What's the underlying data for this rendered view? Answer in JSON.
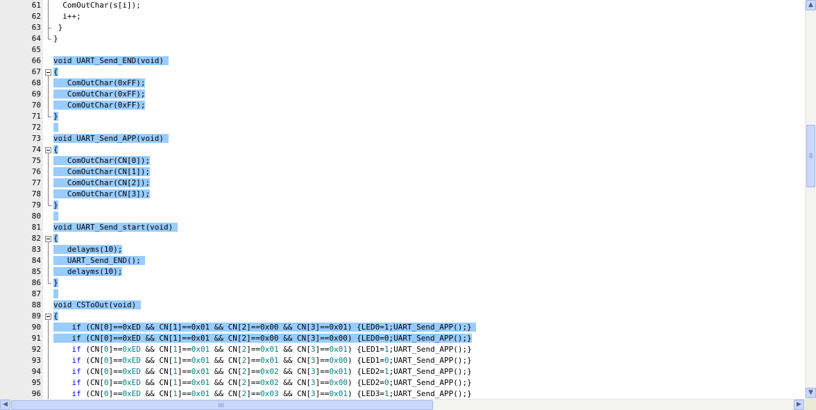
{
  "editor": {
    "lines": [
      {
        "n": "61",
        "indent": "  ",
        "segs": [
          {
            "t": "ComOutChar(s[i]);"
          }
        ]
      },
      {
        "n": "62",
        "indent": "  ",
        "segs": [
          {
            "t": "i++;"
          }
        ]
      },
      {
        "n": "63",
        "indent": " ",
        "segs": [
          {
            "t": "}"
          }
        ]
      },
      {
        "n": "64",
        "indent": "",
        "segs": [
          {
            "t": "}"
          }
        ]
      },
      {
        "n": "65",
        "indent": "",
        "segs": [
          {
            "t": ""
          }
        ]
      },
      {
        "n": "66",
        "indent": "",
        "sel": true,
        "segs": [
          {
            "t": "void UART_Send_END(void) "
          }
        ]
      },
      {
        "n": "67",
        "indent": "",
        "sel": true,
        "segs": [
          {
            "t": "{"
          }
        ]
      },
      {
        "n": "68",
        "indent": "",
        "sel": true,
        "segs": [
          {
            "t": "   ComOutChar(0xFF);"
          }
        ]
      },
      {
        "n": "69",
        "indent": "",
        "sel": true,
        "segs": [
          {
            "t": "   ComOutChar(0xFF);"
          }
        ]
      },
      {
        "n": "70",
        "indent": "",
        "sel": true,
        "segs": [
          {
            "t": "   ComOutChar(0xFF);"
          }
        ]
      },
      {
        "n": "71",
        "indent": "",
        "sel": true,
        "segs": [
          {
            "t": "}"
          }
        ]
      },
      {
        "n": "72",
        "indent": "",
        "sel": true,
        "segs": [
          {
            "t": " "
          }
        ]
      },
      {
        "n": "73",
        "indent": "",
        "sel": true,
        "segs": [
          {
            "t": "void UART_Send_APP(void) "
          }
        ]
      },
      {
        "n": "74",
        "indent": "",
        "sel": true,
        "segs": [
          {
            "t": "{"
          }
        ]
      },
      {
        "n": "75",
        "indent": "",
        "sel": true,
        "segs": [
          {
            "t": "   ComOutChar(CN[0]);"
          }
        ]
      },
      {
        "n": "76",
        "indent": "",
        "sel": true,
        "segs": [
          {
            "t": "   ComOutChar(CN[1]);"
          }
        ]
      },
      {
        "n": "77",
        "indent": "",
        "sel": true,
        "segs": [
          {
            "t": "   ComOutChar(CN[2]);"
          }
        ]
      },
      {
        "n": "78",
        "indent": "",
        "sel": true,
        "segs": [
          {
            "t": "   ComOutChar(CN[3]);"
          }
        ]
      },
      {
        "n": "79",
        "indent": "",
        "sel": true,
        "segs": [
          {
            "t": "}"
          }
        ]
      },
      {
        "n": "80",
        "indent": "",
        "sel": true,
        "segs": [
          {
            "t": " "
          }
        ]
      },
      {
        "n": "81",
        "indent": "",
        "sel": true,
        "segs": [
          {
            "t": "void UART_Send_start(void) "
          }
        ]
      },
      {
        "n": "82",
        "indent": "",
        "sel": true,
        "segs": [
          {
            "t": "{"
          }
        ]
      },
      {
        "n": "83",
        "indent": "",
        "sel": true,
        "segs": [
          {
            "t": "   delayms(10);"
          }
        ]
      },
      {
        "n": "84",
        "indent": "",
        "sel": true,
        "segs": [
          {
            "t": "   UART_Send_END(); "
          }
        ]
      },
      {
        "n": "85",
        "indent": "",
        "sel": true,
        "segs": [
          {
            "t": "   delayms(10);"
          }
        ]
      },
      {
        "n": "86",
        "indent": "",
        "sel": true,
        "segs": [
          {
            "t": "}"
          }
        ]
      },
      {
        "n": "87",
        "indent": "",
        "sel": true,
        "segs": [
          {
            "t": " "
          }
        ]
      },
      {
        "n": "88",
        "indent": "",
        "sel": true,
        "segs": [
          {
            "t": "void CSToOut(void) "
          }
        ]
      },
      {
        "n": "89",
        "indent": "",
        "sel": true,
        "segs": [
          {
            "t": "{"
          }
        ]
      },
      {
        "n": "90",
        "indent": "",
        "sel": true,
        "segs": [
          {
            "t": "    if (CN[0]==0xED && CN[1]==0x01 && CN[2]==0x00 && CN[3]==0x01) {LED0=1;UART_Send_APP();} "
          }
        ]
      },
      {
        "n": "91",
        "indent": "",
        "sel": true,
        "segs": [
          {
            "t": "    if (CN[0]==0xED && CN[1]==0x01 && CN[2]==0x00 && CN[3]==0x00) {LED0=0;UART_Send_APP();}"
          }
        ]
      },
      {
        "n": "92",
        "indent": "    ",
        "segs": [
          {
            "t": "if",
            "c": "kw"
          },
          {
            "t": " (CN["
          },
          {
            "t": "0",
            "c": "num"
          },
          {
            "t": "]=="
          },
          {
            "t": "0xED",
            "c": "num"
          },
          {
            "t": " && CN["
          },
          {
            "t": "1",
            "c": "num"
          },
          {
            "t": "]=="
          },
          {
            "t": "0x01",
            "c": "num"
          },
          {
            "t": " && CN["
          },
          {
            "t": "2",
            "c": "num"
          },
          {
            "t": "]=="
          },
          {
            "t": "0x01",
            "c": "num"
          },
          {
            "t": " && CN["
          },
          {
            "t": "3",
            "c": "num"
          },
          {
            "t": "]=="
          },
          {
            "t": "0x01",
            "c": "num"
          },
          {
            "t": ") {LED1="
          },
          {
            "t": "1",
            "c": "num"
          },
          {
            "t": ";UART_Send_APP();}"
          }
        ]
      },
      {
        "n": "93",
        "indent": "    ",
        "segs": [
          {
            "t": "if",
            "c": "kw"
          },
          {
            "t": " (CN["
          },
          {
            "t": "0",
            "c": "num"
          },
          {
            "t": "]=="
          },
          {
            "t": "0xED",
            "c": "num"
          },
          {
            "t": " && CN["
          },
          {
            "t": "1",
            "c": "num"
          },
          {
            "t": "]=="
          },
          {
            "t": "0x01",
            "c": "num"
          },
          {
            "t": " && CN["
          },
          {
            "t": "2",
            "c": "num"
          },
          {
            "t": "]=="
          },
          {
            "t": "0x01",
            "c": "num"
          },
          {
            "t": " && CN["
          },
          {
            "t": "3",
            "c": "num"
          },
          {
            "t": "]=="
          },
          {
            "t": "0x00",
            "c": "num"
          },
          {
            "t": ") {LED1="
          },
          {
            "t": "0",
            "c": "num"
          },
          {
            "t": ";UART_Send_APP();}"
          }
        ]
      },
      {
        "n": "94",
        "indent": "    ",
        "segs": [
          {
            "t": "if",
            "c": "kw"
          },
          {
            "t": " (CN["
          },
          {
            "t": "0",
            "c": "num"
          },
          {
            "t": "]=="
          },
          {
            "t": "0xED",
            "c": "num"
          },
          {
            "t": " && CN["
          },
          {
            "t": "1",
            "c": "num"
          },
          {
            "t": "]=="
          },
          {
            "t": "0x01",
            "c": "num"
          },
          {
            "t": " && CN["
          },
          {
            "t": "2",
            "c": "num"
          },
          {
            "t": "]=="
          },
          {
            "t": "0x02",
            "c": "num"
          },
          {
            "t": " && CN["
          },
          {
            "t": "3",
            "c": "num"
          },
          {
            "t": "]=="
          },
          {
            "t": "0x01",
            "c": "num"
          },
          {
            "t": ") {LED2="
          },
          {
            "t": "1",
            "c": "num"
          },
          {
            "t": ";UART_Send_APP();}"
          }
        ]
      },
      {
        "n": "95",
        "indent": "    ",
        "segs": [
          {
            "t": "if",
            "c": "kw"
          },
          {
            "t": " (CN["
          },
          {
            "t": "0",
            "c": "num"
          },
          {
            "t": "]=="
          },
          {
            "t": "0xED",
            "c": "num"
          },
          {
            "t": " && CN["
          },
          {
            "t": "1",
            "c": "num"
          },
          {
            "t": "]=="
          },
          {
            "t": "0x01",
            "c": "num"
          },
          {
            "t": " && CN["
          },
          {
            "t": "2",
            "c": "num"
          },
          {
            "t": "]=="
          },
          {
            "t": "0x02",
            "c": "num"
          },
          {
            "t": " && CN["
          },
          {
            "t": "3",
            "c": "num"
          },
          {
            "t": "]=="
          },
          {
            "t": "0x00",
            "c": "num"
          },
          {
            "t": ") {LED2="
          },
          {
            "t": "0",
            "c": "num"
          },
          {
            "t": ";UART_Send_APP();}"
          }
        ]
      },
      {
        "n": "96",
        "indent": "    ",
        "segs": [
          {
            "t": "if",
            "c": "kw"
          },
          {
            "t": " (CN["
          },
          {
            "t": "0",
            "c": "num"
          },
          {
            "t": "]=="
          },
          {
            "t": "0xED",
            "c": "num"
          },
          {
            "t": " && CN["
          },
          {
            "t": "1",
            "c": "num"
          },
          {
            "t": "]=="
          },
          {
            "t": "0x01",
            "c": "num"
          },
          {
            "t": " && CN["
          },
          {
            "t": "2",
            "c": "num"
          },
          {
            "t": "]=="
          },
          {
            "t": "0x03",
            "c": "num"
          },
          {
            "t": " && CN["
          },
          {
            "t": "3",
            "c": "num"
          },
          {
            "t": "]=="
          },
          {
            "t": "0x01",
            "c": "num"
          },
          {
            "t": ") {LED3="
          },
          {
            "t": "1",
            "c": "num"
          },
          {
            "t": ";UART_Send_APP();}"
          }
        ]
      }
    ],
    "selection_color": "#99ccff",
    "keyword_color": "#0000ff",
    "number_color": "#008080"
  },
  "scrollbars": {
    "left_arrow_icon": "arrow-left-icon",
    "right_arrow_icon": "arrow-right-icon",
    "up_arrow_icon": "arrow-up-icon",
    "down_arrow_icon": "arrow-down-icon"
  }
}
